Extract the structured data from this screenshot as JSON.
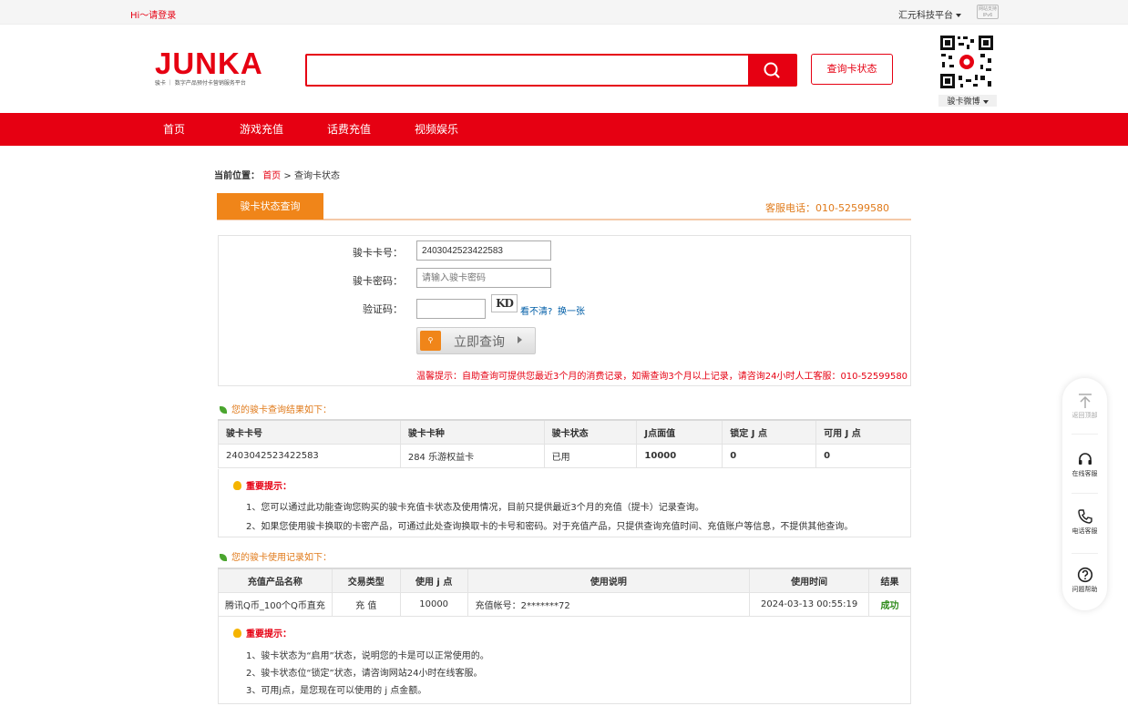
{
  "topbar": {
    "login": "Hi～请登录",
    "platform": "汇元科技平台",
    "badge_line1": "网站支持",
    "badge_line2": "IPv6"
  },
  "header": {
    "logo": "JUNKA",
    "logo_tagline": "骏卡 ｜ 数字产品预付卡营销服务平台",
    "search_value": "",
    "query_button": "查询卡状态",
    "qr_label": "骏卡微博"
  },
  "nav": [
    "首页",
    "游戏充值",
    "话费充值",
    "视频娱乐"
  ],
  "breadcrumb": {
    "label": "当前位置：",
    "home": "首页",
    "sep": ">",
    "current": "查询卡状态"
  },
  "tab": {
    "label": "骏卡状态查询",
    "phone": "客服电话：010-52599580"
  },
  "form": {
    "card_no_label": "骏卡卡号：",
    "card_no_value": "2403042523422583",
    "password_label": "骏卡密码：",
    "password_placeholder": "请输入骏卡密码",
    "captcha_label": "验证码：",
    "captcha_text": "KD",
    "cant_see": "看不清?",
    "change": "换一张",
    "submit": "立即查询",
    "tip": "温馨提示：自助查询可提供您最近3个月的消费记录，如需查询3个月以上记录，请咨询24小时人工客服：010-52599580"
  },
  "result": {
    "title": "您的骏卡查询结果如下：",
    "headers": [
      "骏卡卡号",
      "骏卡卡种",
      "骏卡状态",
      "J点面值",
      "锁定 J 点",
      "可用 J 点"
    ],
    "row": [
      "2403042523422583",
      "284 乐游权益卡",
      "已用",
      "10000",
      "0",
      "0"
    ],
    "note_head": "重要提示：",
    "notes": [
      "1、您可以通过此功能查询您购买的骏卡充值卡状态及使用情况，目前只提供最近3个月的充值（提卡）记录查询。",
      "2、如果您使用骏卡换取的卡密产品，可通过此处查询换取卡的卡号和密码。对于充值产品，只提供查询充值时间、充值账户等信息，不提供其他查询。"
    ]
  },
  "usage": {
    "title": "您的骏卡使用记录如下：",
    "headers": [
      "充值产品名称",
      "交易类型",
      "使用 j 点",
      "使用说明",
      "使用时间",
      "结果"
    ],
    "row": [
      "腾讯Q币_100个Q币直充",
      "充 值",
      "10000",
      "充值帐号：2*******72",
      "2024-03-13 00:55:19",
      "成功"
    ],
    "note_head": "重要提示：",
    "notes": [
      "1、骏卡状态为“启用”状态，说明您的卡是可以正常使用的。",
      "2、骏卡状态位“锁定”状态，请咨询网站24小时在线客服。",
      "3、可用j点，是您现在可以使用的 j 点金额。"
    ]
  },
  "sidebar": [
    "返回顶部",
    "在线客服",
    "电话客服",
    "问题帮助"
  ],
  "colors": {
    "brand": "#e60012",
    "accent": "#f08519",
    "success": "#2e8b1a",
    "link": "#005ea7"
  }
}
